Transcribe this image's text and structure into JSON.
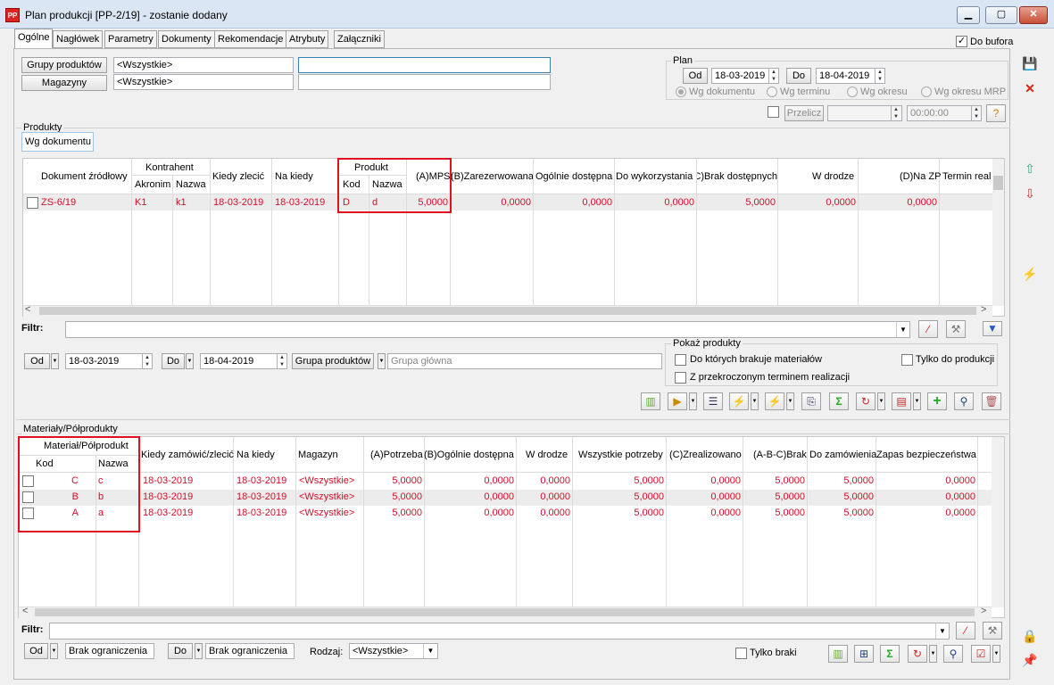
{
  "window": {
    "title": "Plan produkcji [PP-2/19] - zostanie dodany",
    "icon_text": "PP",
    "min": "▁",
    "max": "▢",
    "close": "✕"
  },
  "tabs": [
    "Ogólne",
    "Nagłówek",
    "Parametry",
    "Dokumenty",
    "Rekomendacje",
    "Atrybuty",
    "Załączniki"
  ],
  "do_bufora": "Do bufora",
  "top": {
    "grupy_btn": "Grupy produktów",
    "grupy_value": "<Wszystkie>",
    "magazyny_btn": "Magazyny",
    "magazyny_value": "<Wszystkie>"
  },
  "plan": {
    "legend": "Plan",
    "od_btn": "Od",
    "od_date": "18-03-2019",
    "do_btn": "Do",
    "do_date": "18-04-2019",
    "radios": [
      "Wg dokumentu",
      "Wg terminu",
      "Wg okresu",
      "Wg okresu MRP"
    ],
    "przelicz": "Przelicz",
    "time": "00:00:00"
  },
  "produkty": {
    "legend": "Produkty",
    "tab": "Wg dokumentu",
    "headers": {
      "doc": "Dokument źródłowy",
      "kontrahent": "Kontrahent",
      "akronim": "Akronim",
      "nazwa": "Nazwa",
      "kiedy": "Kiedy zlecić",
      "nakiedy": "Na kiedy",
      "produkt": "Produkt",
      "kod": "Kod",
      "pnazwa": "Nazwa",
      "mps": "(A)MPS",
      "zarez": "(B)Zarezerwowana",
      "ogolnie": "Ogólnie dostępna",
      "dowyk": "Do wykorzystania",
      "brak": "(C)Brak dostępnych",
      "wdrodze": "W drodze",
      "nazp": "(D)Na ZP",
      "termin": "Termin real"
    },
    "row": {
      "doc": "ZS-6/19",
      "akronim": "K1",
      "nazwa": "k1",
      "kiedy": "18-03-2019",
      "nakiedy": "18-03-2019",
      "kod": "D",
      "pnazwa": "d",
      "mps": "5,0000",
      "zarez": "0,0000",
      "ogolnie": "0,0000",
      "dowyk": "0,0000",
      "brak": "5,0000",
      "wdrodze": "0,0000",
      "nazp": "0,0000"
    },
    "filtr_label": "Filtr:",
    "od_btn": "Od",
    "od_date": "18-03-2019",
    "do_btn": "Do",
    "do_date": "18-04-2019",
    "grupa_btn": "Grupa produktów",
    "grupa_value": "Grupa główna",
    "pokaz": {
      "legend": "Pokaż produkty",
      "opt1": "Do których brakuje materiałów",
      "opt2": "Tylko do produkcji",
      "opt3": "Z przekroczonym terminem realizacji"
    }
  },
  "materialy": {
    "legend": "Materiały/Półprodukty",
    "headers": {
      "mat": "Materiał/Półprodukt",
      "kod": "Kod",
      "nazwa": "Nazwa",
      "kiedy": "Kiedy zamówić/zlecić",
      "nakiedy": "Na kiedy",
      "magazyn": "Magazyn",
      "potrzeba": "(A)Potrzeba",
      "ogolnie": "(B)Ogólnie dostępna",
      "wdrodze": "W drodze",
      "wszystkie": "Wszystkie potrzeby",
      "zreal": "(C)Zrealizowano",
      "brak": "(A-B-C)Brak",
      "dozam": "Do zamówienia",
      "zapas": "Zapas bezpieczeństwa"
    },
    "rows": [
      {
        "kod": "C",
        "nazwa": "c",
        "kiedy": "18-03-2019",
        "nakiedy": "18-03-2019",
        "magazyn": "<Wszystkie>",
        "potrzeba": "5,0000",
        "ogolnie": "0,0000",
        "wdrodze": "0,0000",
        "wszystkie": "5,0000",
        "zreal": "0,0000",
        "brak": "5,0000",
        "dozam": "5,0000",
        "zapas": "0,0000"
      },
      {
        "kod": "B",
        "nazwa": "b",
        "kiedy": "18-03-2019",
        "nakiedy": "18-03-2019",
        "magazyn": "<Wszystkie>",
        "potrzeba": "5,0000",
        "ogolnie": "0,0000",
        "wdrodze": "0,0000",
        "wszystkie": "5,0000",
        "zreal": "0,0000",
        "brak": "5,0000",
        "dozam": "5,0000",
        "zapas": "0,0000"
      },
      {
        "kod": "A",
        "nazwa": "a",
        "kiedy": "18-03-2019",
        "nakiedy": "18-03-2019",
        "magazyn": "<Wszystkie>",
        "potrzeba": "5,0000",
        "ogolnie": "0,0000",
        "wdrodze": "0,0000",
        "wszystkie": "5,0000",
        "zreal": "0,0000",
        "brak": "5,0000",
        "dozam": "5,0000",
        "zapas": "0,0000"
      }
    ],
    "filtr_label": "Filtr:",
    "od_btn": "Od",
    "od_value": "Brak ograniczenia",
    "do_btn": "Do",
    "do_value": "Brak ograniczenia",
    "rodzaj_label": "Rodzaj:",
    "rodzaj_value": "<Wszystkie>",
    "tylko_braki": "Tylko braki"
  }
}
